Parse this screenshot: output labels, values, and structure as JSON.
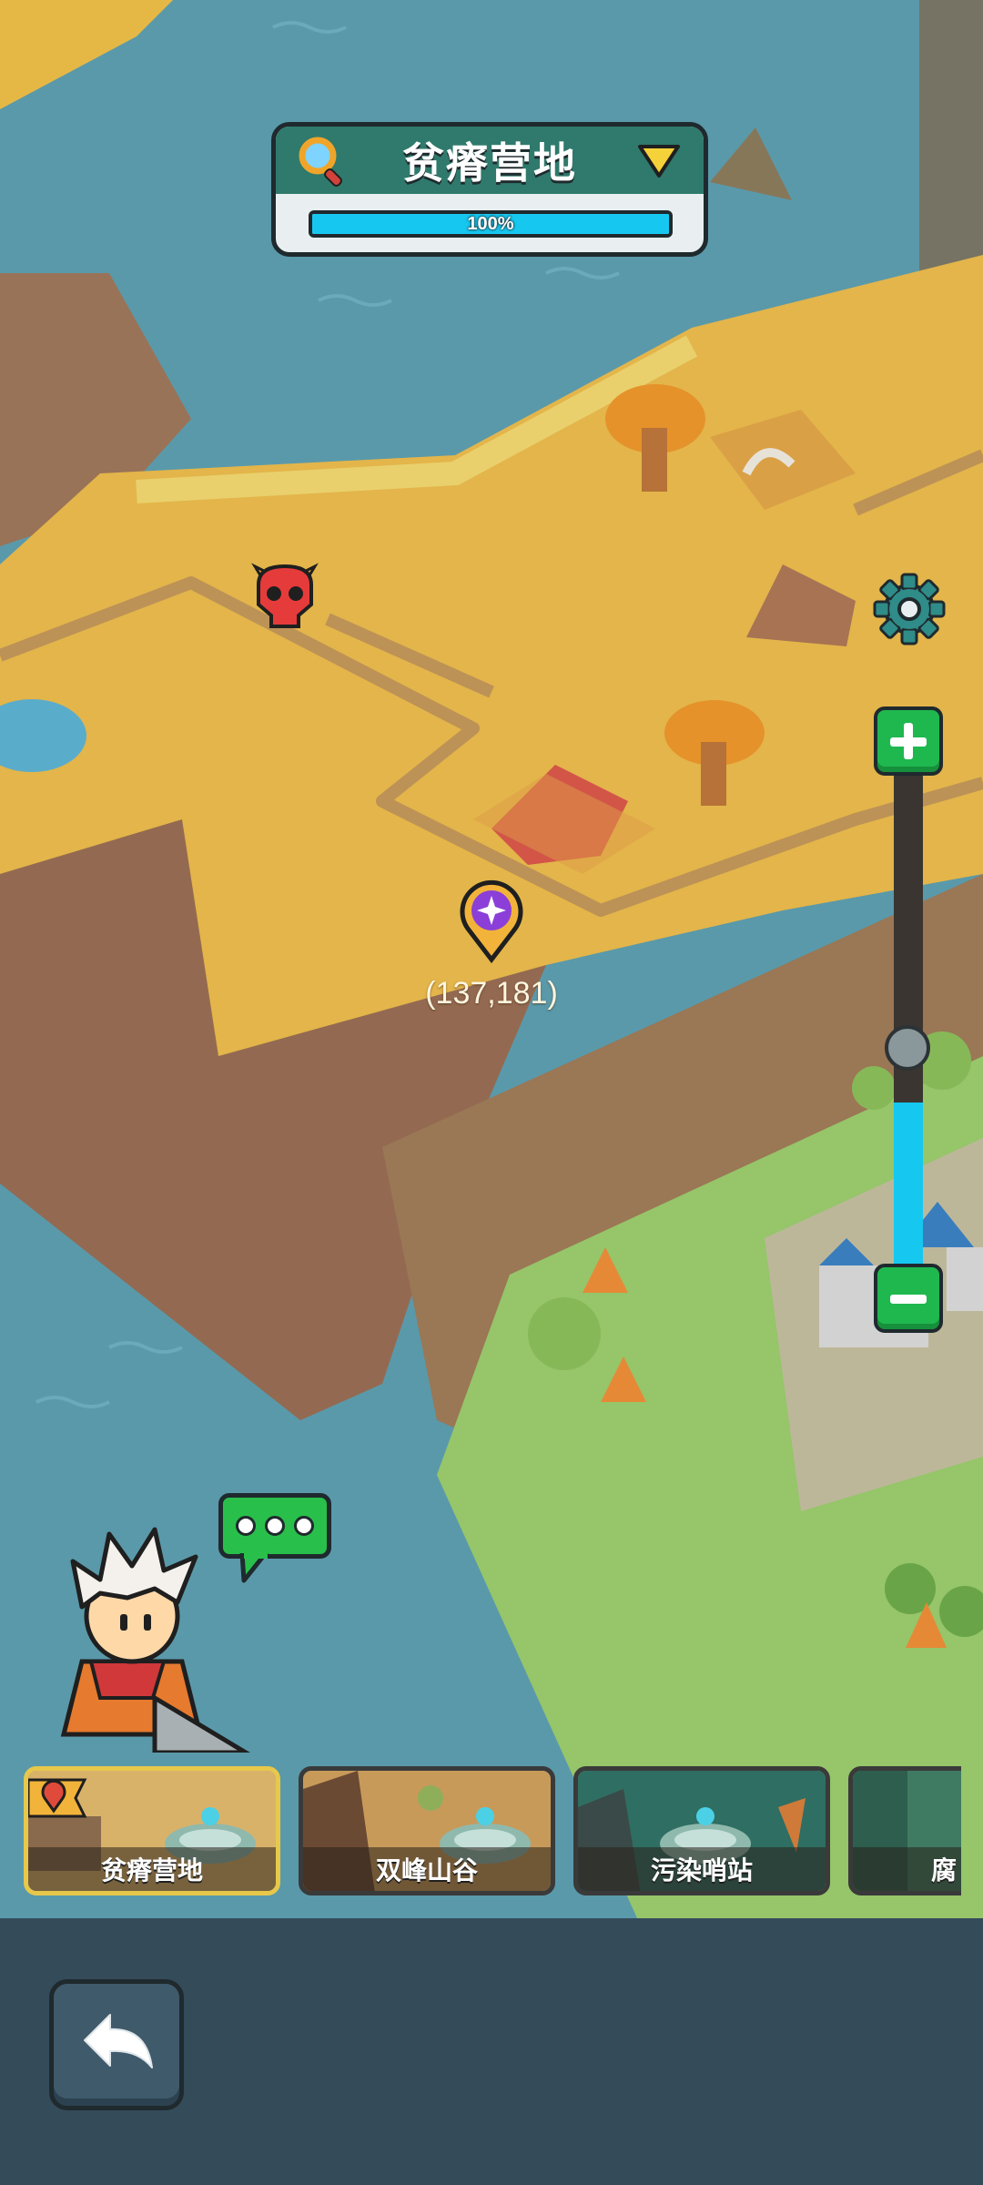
{
  "region_header": {
    "title": "贫瘠营地",
    "progress": 1.0,
    "progress_text": "100%"
  },
  "map": {
    "coordinate": "(137,181)",
    "markers": {
      "enemy_icon": "demon-skull-icon",
      "location_pin_icon": "star-pin-icon"
    }
  },
  "zoom": {
    "level": 0.36
  },
  "regions": [
    {
      "label": "贫瘠营地",
      "active": true
    },
    {
      "label": "双峰山谷",
      "active": false
    },
    {
      "label": "污染哨站",
      "active": false
    },
    {
      "label": "腐",
      "active": false
    }
  ],
  "colors": {
    "progress": "#16c8f0",
    "zoom_button": "#1fb84f",
    "header": "#2f7a6c",
    "active_card_border": "#e8c84a"
  },
  "icons": {
    "search": "magnifier-icon",
    "dropdown": "triangle-down-icon",
    "settings": "gear-icon",
    "zoom_in": "plus-icon",
    "zoom_out": "minus-icon",
    "chat": "speech-bubble-icon",
    "back": "back-arrow-icon"
  }
}
